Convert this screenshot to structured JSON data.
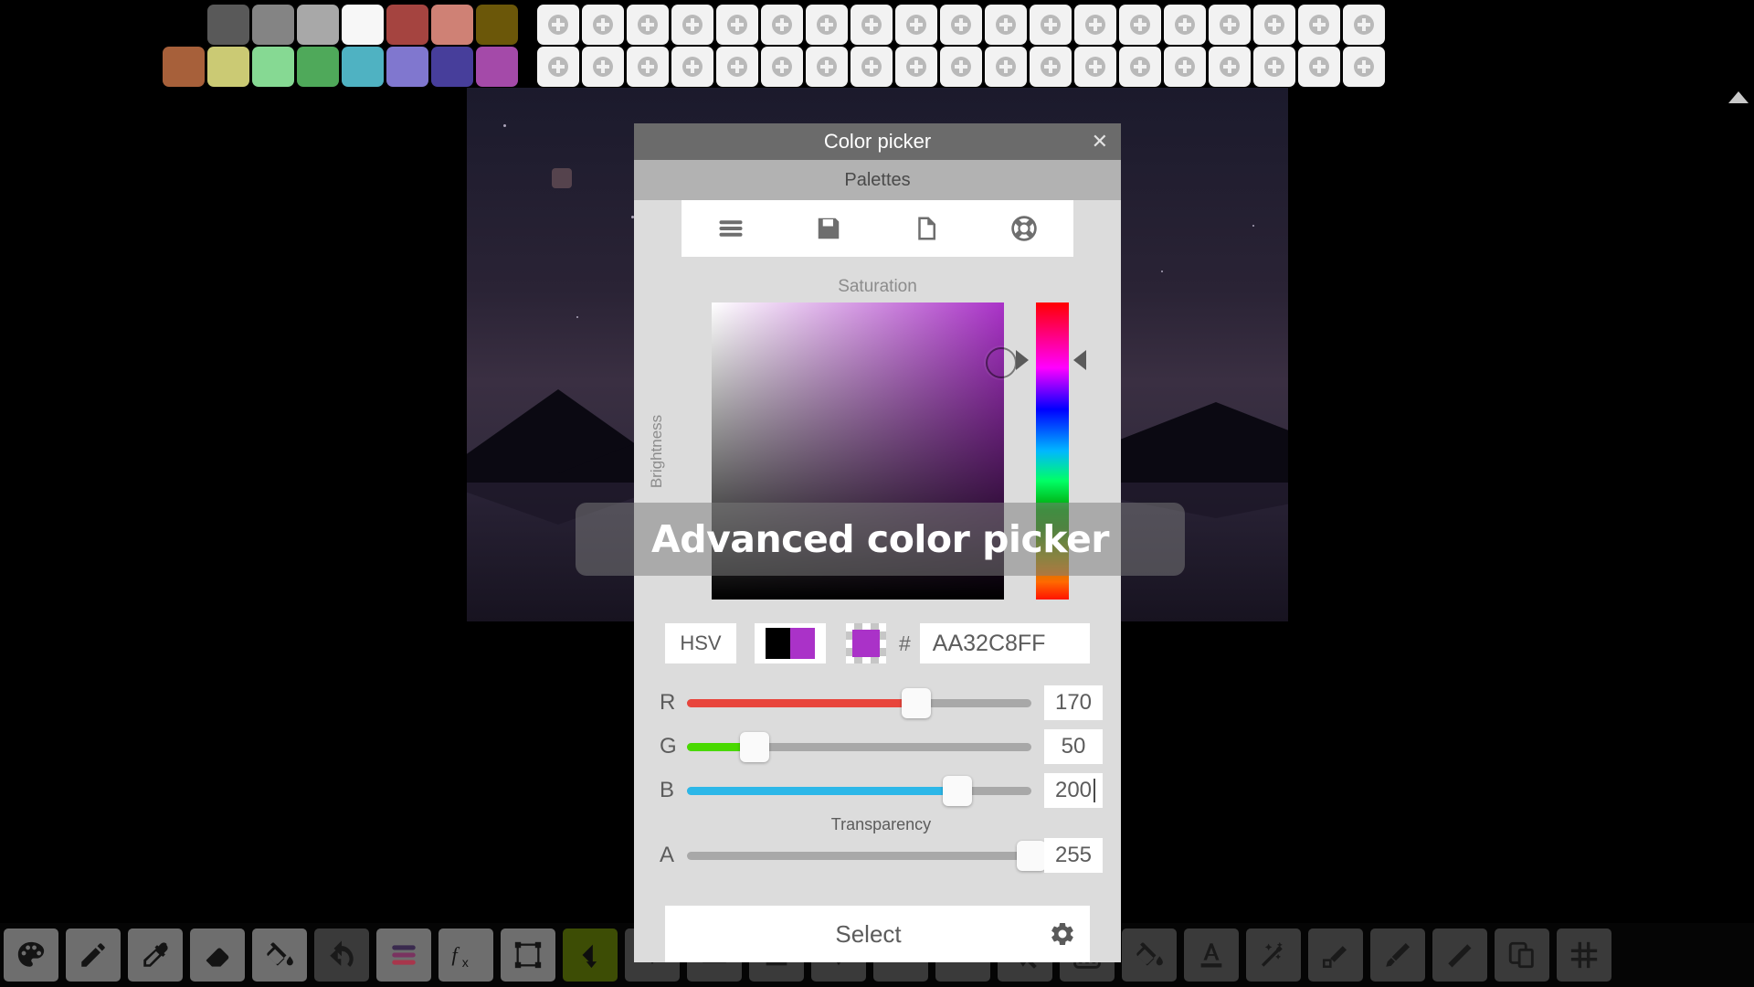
{
  "app": {
    "title": "Advanced color picker",
    "toast_message": "Advanced color picker"
  },
  "palette_strip": {
    "row1": [
      {
        "name": "dark-grey",
        "color": "#595959",
        "empty": false
      },
      {
        "name": "mid-grey",
        "color": "#848484",
        "empty": false
      },
      {
        "name": "light-grey",
        "color": "#a8a8a8",
        "empty": false
      },
      {
        "name": "white",
        "color": "#f7f7f7",
        "empty": false
      },
      {
        "name": "brick-red",
        "color": "#a54440",
        "empty": false
      },
      {
        "name": "salmon",
        "color": "#cf8175",
        "empty": false
      },
      {
        "name": "olive-dark",
        "color": "#6b5709",
        "empty": false
      }
    ],
    "row1_empty_count": 19,
    "row2": [
      {
        "name": "sienna",
        "color": "#a7603a",
        "empty": false
      },
      {
        "name": "khaki",
        "color": "#cbca74",
        "empty": false
      },
      {
        "name": "mint-green",
        "color": "#86d993",
        "empty": false
      },
      {
        "name": "grass-green",
        "color": "#4fa95a",
        "empty": false
      },
      {
        "name": "teal",
        "color": "#4fb2c2",
        "empty": false
      },
      {
        "name": "periwinkle",
        "color": "#8077cf",
        "empty": false
      },
      {
        "name": "indigo",
        "color": "#473e9b",
        "empty": false
      },
      {
        "name": "orchid",
        "color": "#a44aa9",
        "empty": false
      }
    ],
    "row2_empty_count": 19,
    "empty_slot_icon": "plus-icon"
  },
  "dialog": {
    "title": "Color picker",
    "close_icon": "close-icon",
    "palettes_label": "Palettes",
    "palette_tools": [
      {
        "name": "menu-icon",
        "label": "Menu"
      },
      {
        "name": "save-icon",
        "label": "Save palette"
      },
      {
        "name": "document-icon",
        "label": "New palette"
      },
      {
        "name": "lifebuoy-icon",
        "label": "Help"
      }
    ],
    "saturation_label": "Saturation",
    "brightness_label": "Brightness",
    "mode_button": "HSV",
    "hash_symbol": "#",
    "hex_value": "AA32C8FF",
    "hex_placeholder": "AA32C8FF",
    "old_color": "#000000",
    "new_color": "#AA32C8",
    "channels": [
      {
        "label": "R",
        "value": "170",
        "max": 255,
        "fill": "#e8453c",
        "focused": false
      },
      {
        "label": "G",
        "value": "50",
        "max": 255,
        "fill": "#49d900",
        "focused": false
      },
      {
        "label": "B",
        "value": "200",
        "max": 255,
        "fill": "#2cb7e8",
        "focused": true
      },
      {
        "label": "A",
        "value": "255",
        "max": 255,
        "fill": "#8e8e8e",
        "focused": false
      }
    ],
    "transparency_label": "Transparency",
    "select_label": "Select",
    "settings_icon": "gear-icon",
    "hue_marker_left_icon": "triangle-right-icon",
    "hue_marker_right_icon": "triangle-left-icon"
  },
  "toolbar": {
    "left_tools": [
      {
        "name": "palette-tool",
        "icon": "palette-icon",
        "state": "normal"
      },
      {
        "name": "pencil-tool",
        "icon": "pencil-icon",
        "state": "normal"
      },
      {
        "name": "eyedropper-tool",
        "icon": "eyedropper-icon",
        "state": "normal"
      },
      {
        "name": "eraser-tool",
        "icon": "eraser-icon",
        "state": "normal"
      },
      {
        "name": "bucket-tool",
        "icon": "paint-bucket-icon",
        "state": "normal"
      },
      {
        "name": "undo-tool",
        "icon": "undo-arrow-icon",
        "state": "dark"
      },
      {
        "name": "layers-tool",
        "icon": "layers-icon",
        "state": "normal"
      },
      {
        "name": "effects-tool",
        "icon": "fx-icon",
        "state": "normal"
      },
      {
        "name": "transform-tool",
        "icon": "transform-icon",
        "state": "normal"
      },
      {
        "name": "back-tool",
        "icon": "arrow-left-icon",
        "state": "accent"
      }
    ],
    "middle_tools": [
      {
        "name": "down-arrow-tool",
        "icon": "chevron-down-icon",
        "state": "dark"
      },
      {
        "name": "frames-tool",
        "icon": "film-icon",
        "state": "dark"
      },
      {
        "name": "shape-tool",
        "icon": "shape-icon",
        "state": "dark"
      },
      {
        "name": "check-tool",
        "icon": "check-icon",
        "state": "dark"
      },
      {
        "name": "minus-tool",
        "icon": "minus-icon",
        "state": "dark"
      },
      {
        "name": "rect-tool",
        "icon": "rectangle-icon",
        "state": "dark"
      },
      {
        "name": "zoom-tool",
        "icon": "magnifier-icon",
        "state": "dark"
      }
    ],
    "right_tools": [
      {
        "name": "dither-tool",
        "icon": "checkerboard-icon",
        "state": "dark"
      },
      {
        "name": "fill-tool",
        "icon": "paint-bucket-icon",
        "state": "dark"
      },
      {
        "name": "text-tool",
        "icon": "text-a-icon",
        "state": "dark"
      },
      {
        "name": "magic-wand-tool",
        "icon": "magic-wand-icon",
        "state": "dark"
      },
      {
        "name": "pixel-pen-tool",
        "icon": "pixel-pen-icon",
        "state": "dark"
      },
      {
        "name": "brush-tool",
        "icon": "brush-icon",
        "state": "dark"
      },
      {
        "name": "line-pen-tool",
        "icon": "pen-icon",
        "state": "dark"
      },
      {
        "name": "duplicate-tool",
        "icon": "copy-icon",
        "state": "dark"
      },
      {
        "name": "grid-tool",
        "icon": "grid-icon",
        "state": "dark"
      }
    ]
  },
  "corner": {
    "expand_icon": "triangle-up-icon"
  }
}
